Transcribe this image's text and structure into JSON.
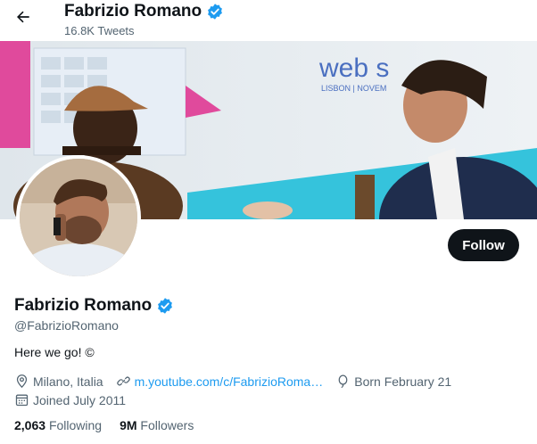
{
  "header": {
    "title": "Fabrizio Romano",
    "tweets_count": "16.8K Tweets"
  },
  "profile": {
    "name": "Fabrizio Romano",
    "handle": "@FabrizioRomano",
    "bio": "Here we go! ©",
    "follow_label": "Follow",
    "verified_color": "#1d9bf0"
  },
  "meta": {
    "location": "Milano, Italia",
    "link": "m.youtube.com/c/FabrizioRoma…",
    "birthday": "Born February 21",
    "joined": "Joined July 2011"
  },
  "stats": {
    "following_count": "2,063",
    "following_label": "Following",
    "followers_count": "9M",
    "followers_label": "Followers"
  },
  "icons": [
    "back-arrow-icon",
    "verified-badge-icon",
    "location-icon",
    "link-icon",
    "balloon-icon",
    "calendar-icon"
  ]
}
